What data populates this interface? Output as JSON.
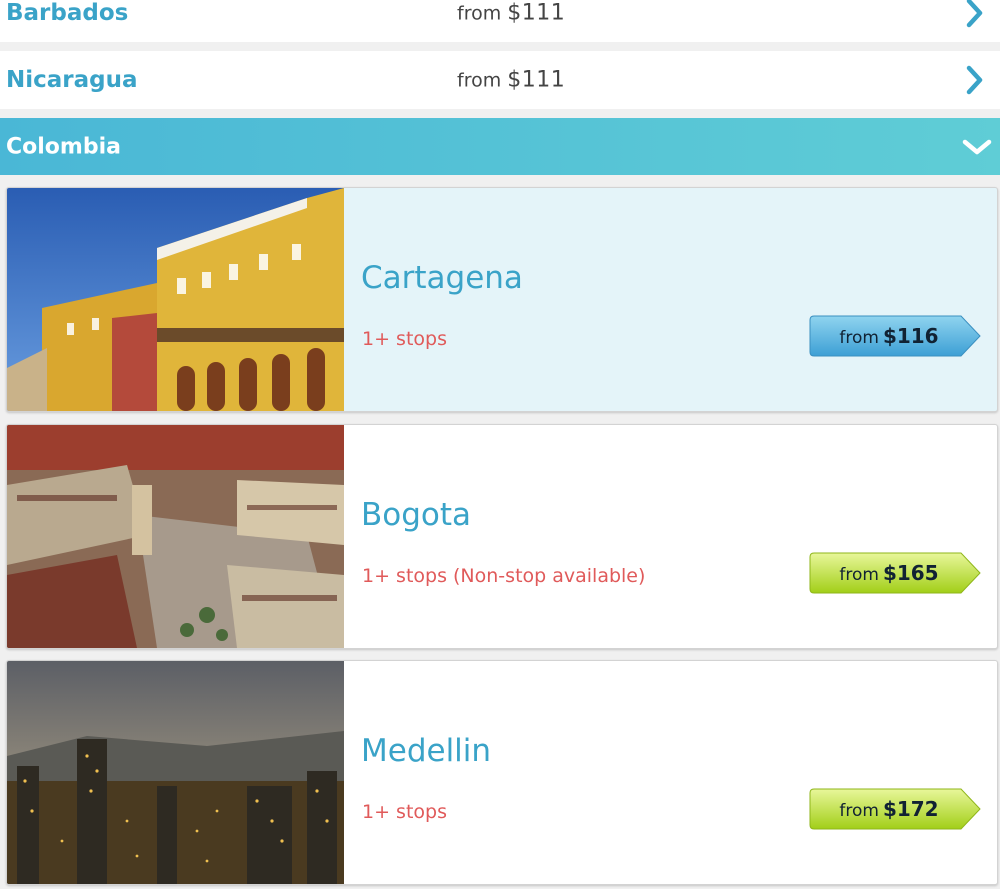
{
  "countries": {
    "barbados": {
      "name": "Barbados",
      "from": "from",
      "price": "$111"
    },
    "nicaragua": {
      "name": "Nicaragua",
      "from": "from",
      "price": "$111"
    },
    "colombia": {
      "name": "Colombia"
    }
  },
  "cities": [
    {
      "name": "Cartagena",
      "stops": "1+ stops",
      "from": "from",
      "price": "$116",
      "tag_color": "blue"
    },
    {
      "name": "Bogota",
      "stops": "1+ stops (Non-stop available)",
      "from": "from",
      "price": "$165",
      "tag_color": "green"
    },
    {
      "name": "Medellin",
      "stops": "1+ stops",
      "from": "from",
      "price": "$172",
      "tag_color": "green"
    }
  ],
  "colors": {
    "link_blue": "#3aa3c8",
    "stops_red": "#e05a5a",
    "header_gradient": [
      "#4ab7d6",
      "#5fcdd6"
    ],
    "tag_blue": [
      "#7dcbea",
      "#3ba0d6"
    ],
    "tag_green": [
      "#dcf27a",
      "#a6d21c"
    ]
  }
}
